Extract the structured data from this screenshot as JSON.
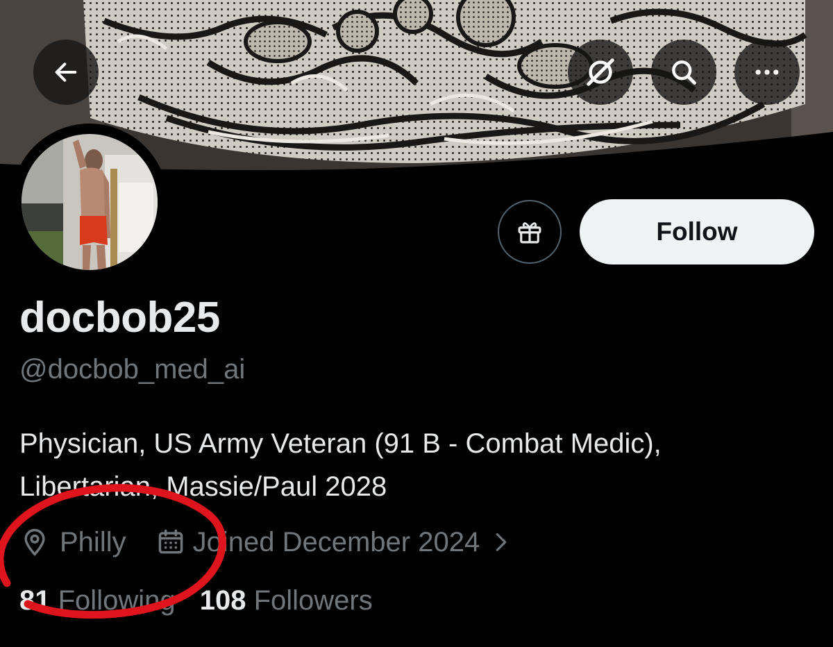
{
  "header": {
    "back_icon": "arrow-left-icon",
    "grok_icon": "grok-icon",
    "search_icon": "search-icon",
    "more_icon": "more-horizontal-icon"
  },
  "profile": {
    "display_name": "docbob25",
    "handle": "@docbob_med_ai",
    "bio_line1": "Physician, US Army Veteran (91 B - Combat Medic),",
    "bio_line2": "Libertarian, Massie/Paul 2028",
    "location": "Philly",
    "joined": "Joined December 2024",
    "following_count": "81",
    "following_label": "Following",
    "followers_count": "108",
    "followers_label": "Followers"
  },
  "actions": {
    "follow_label": "Follow",
    "gift_icon": "gift-icon"
  },
  "colors": {
    "background": "#000000",
    "primary_text": "#e7e9ea",
    "secondary_text": "#71767b",
    "follow_button_bg": "#eff3f4",
    "annotation_red": "#e0141c"
  }
}
